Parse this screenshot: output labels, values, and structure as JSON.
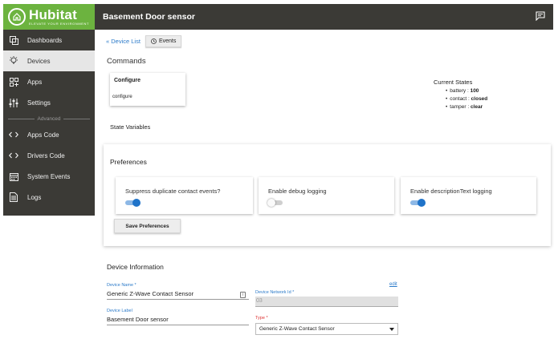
{
  "app": {
    "logo_name": "Hubitat",
    "logo_tagline": "ELEVATE YOUR ENVIRONMENT"
  },
  "sidebar": {
    "items": [
      {
        "label": "Dashboards",
        "icon": "dashboards-icon"
      },
      {
        "label": "Devices",
        "icon": "bulb-icon",
        "active": true
      },
      {
        "label": "Apps",
        "icon": "apps-icon"
      },
      {
        "label": "Settings",
        "icon": "sliders-icon"
      }
    ],
    "advanced_label": "Advanced",
    "advanced_items": [
      {
        "label": "Apps Code",
        "icon": "code-icon"
      },
      {
        "label": "Drivers Code",
        "icon": "code-icon"
      },
      {
        "label": "System Events",
        "icon": "calendar-icon"
      },
      {
        "label": "Logs",
        "icon": "log-icon"
      }
    ]
  },
  "header": {
    "title": "Basement Door sensor",
    "chat_icon": "chat-icon"
  },
  "nav": {
    "back_label": "« Device List",
    "events_label": "Events"
  },
  "commands": {
    "title": "Commands",
    "items": [
      {
        "name": "Configure",
        "button": "configure"
      }
    ]
  },
  "current_states": {
    "title": "Current States",
    "items": [
      {
        "key": "battery",
        "value": "100"
      },
      {
        "key": "contact",
        "value": "closed"
      },
      {
        "key": "tamper",
        "value": "clear"
      }
    ]
  },
  "state_variables": {
    "title": "State Variables"
  },
  "preferences": {
    "title": "Preferences",
    "items": [
      {
        "label": "Suppress duplicate contact events?",
        "enabled": true
      },
      {
        "label": "Enable debug logging",
        "enabled": false
      },
      {
        "label": "Enable descriptionText logging",
        "enabled": true
      }
    ],
    "save_label": "Save Preferences"
  },
  "device_info": {
    "title": "Device Information",
    "name_label": "Device Name *",
    "name_value": "Generic Z-Wave Contact Sensor",
    "label_label": "Device Label",
    "label_value": "Basement Door sensor",
    "network_label": "Device Network Id *",
    "network_value": "03",
    "edit_label": "edit",
    "type_label": "Type *",
    "type_value": "Generic Z-Wave Contact Sensor"
  },
  "colors": {
    "sidebar_bg": "#3b3a36",
    "logo_green": "#6cb33f",
    "link_blue": "#2b7ac9",
    "toggle_on": "#1f73c9"
  }
}
